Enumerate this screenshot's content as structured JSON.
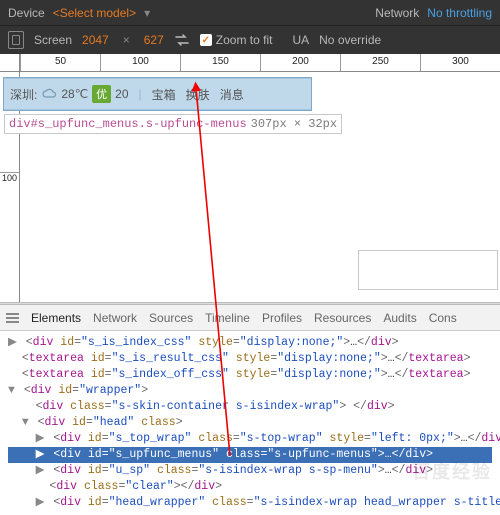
{
  "top": {
    "device_label": "Device",
    "device_value": "<Select model>",
    "network_label": "Network",
    "throttle": "No throttling",
    "ua_label": "UA",
    "ua_value": "No override"
  },
  "tool": {
    "screen_label": "Screen",
    "w": "2047",
    "times": "×",
    "h": "627",
    "zoom": "Zoom to fit"
  },
  "ruler": {
    "ticks": [
      "50",
      "100",
      "150",
      "200",
      "250",
      "300"
    ],
    "v100": "100"
  },
  "page": {
    "city": "深圳:",
    "temp": "28℃",
    "you": "优",
    "aqi": "20",
    "bx": "宝箱",
    "skin": "换肤",
    "msg": "消息"
  },
  "tip": {
    "sel": "div#s_upfunc_menus.s-upfunc-menus",
    "w": "307",
    "px1": "px",
    "x": " × ",
    "h": "32",
    "px2": "px"
  },
  "tabs": {
    "items": [
      "Elements",
      "Network",
      "Sources",
      "Timeline",
      "Profiles",
      "Resources",
      "Audits",
      "Cons"
    ],
    "active": 0
  },
  "dom": {
    "l0": "▶ <div id=\"s_is_index_css\" style=\"display:none;\">…</div>",
    "l1": "  <textarea id=\"s_is_result_css\" style=\"display:none;\">…</textarea>",
    "l2": "  <textarea id=\"s_index_off_css\" style=\"display:none;\">…</textarea>",
    "l3": "▼ <div id=\"wrapper\">",
    "l4": "    <div class=\"s-skin-container s-isindex-wrap\"> </div>",
    "l5": "  ▼ <div id=\"head\" class>",
    "l6": "    ▶ <div id=\"s_top_wrap\" class=\"s-top-wrap\" style=\"left: 0px;\">…</div>",
    "l7": "    ▶ <div id=\"s_upfunc_menus\" class=\"s-upfunc-menus\">…</div>",
    "l8": "    ▶ <div id=\"u_sp\" class=\"s-isindex-wrap s-sp-menu\">…</div>",
    "l9": "      <div class=\"clear\"></div>",
    "l10": "    ▶ <div id=\"head_wrapper\" class=\"s-isindex-wrap head_wrapper s-title"
  }
}
